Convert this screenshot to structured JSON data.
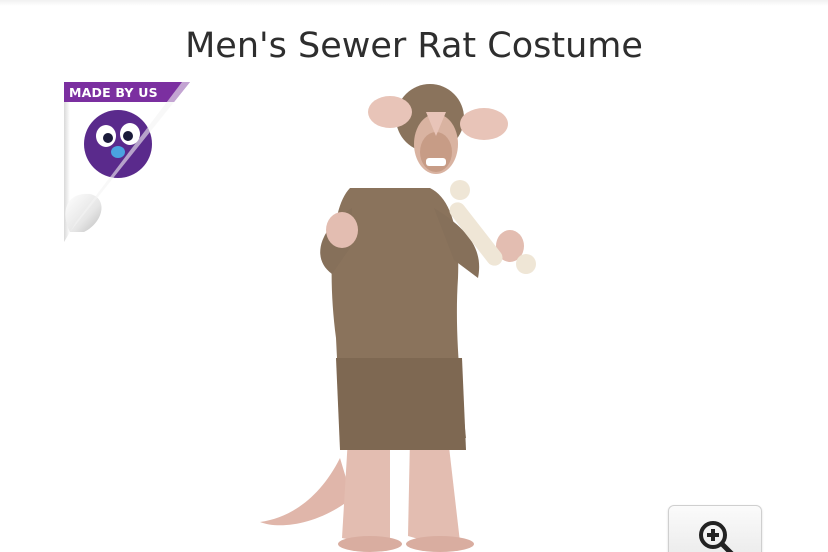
{
  "product": {
    "title": "Men's Sewer Rat Costume"
  },
  "badge": {
    "label": "MADE BY US",
    "icon": "purple-monster-mascot-icon",
    "color": "#7b2fa0"
  },
  "image": {
    "icon": "rat-costume-product-photo"
  },
  "zoom": {
    "icon": "zoom-in-icon"
  },
  "colors": {
    "title_text": "#2e2e2e",
    "badge_purple": "#7b2fa0",
    "fur": "#8a735c",
    "skin_pink": "#e8c4b8"
  }
}
